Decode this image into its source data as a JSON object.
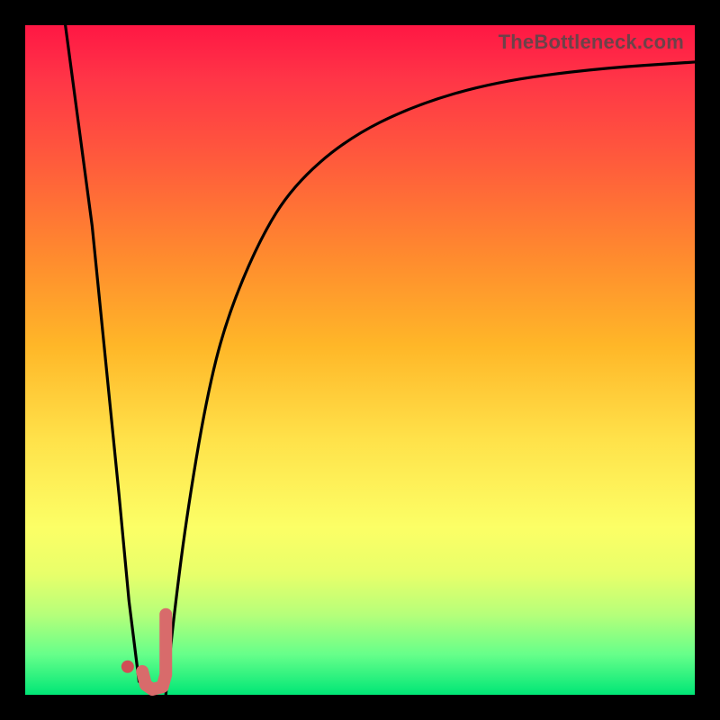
{
  "watermark": "TheBottleneck.com",
  "colors": {
    "curve": "#000000",
    "marker_stroke": "#d86b6b",
    "marker_fill": "#d86b6b",
    "dot_fill": "#d04f55"
  },
  "chart_data": {
    "type": "line",
    "title": "",
    "xlabel": "",
    "ylabel": "",
    "xlim": [
      0,
      100
    ],
    "ylim": [
      0,
      100
    ],
    "series": [
      {
        "name": "left-branch",
        "x": [
          6,
          8,
          10,
          12,
          14,
          15.5,
          17
        ],
        "values": [
          100,
          85,
          70,
          50,
          30,
          14,
          2
        ]
      },
      {
        "name": "right-branch",
        "x": [
          21,
          22,
          24,
          27,
          30,
          35,
          40,
          48,
          58,
          70,
          85,
          100
        ],
        "values": [
          0,
          10,
          26,
          44,
          56,
          68,
          76,
          83,
          88,
          91.5,
          93.5,
          94.5
        ]
      },
      {
        "name": "marker-J",
        "x": [
          17.5,
          18,
          19,
          20.5,
          21,
          21,
          21,
          21
        ],
        "values": [
          3.5,
          1.5,
          0.8,
          1.2,
          3,
          6,
          9,
          12
        ]
      }
    ],
    "annotations": [
      {
        "name": "dot",
        "x": 15.3,
        "y": 4.2
      }
    ]
  }
}
